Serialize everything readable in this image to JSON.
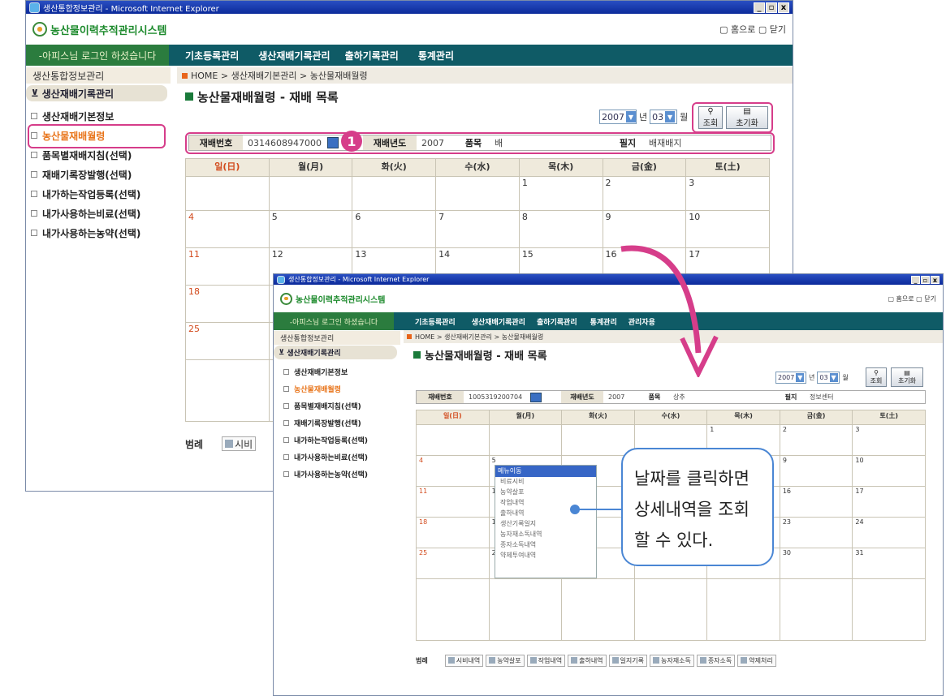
{
  "app_title": "생산통합정보관리 - Microsoft Internet Explorer",
  "win_controls": [
    "_",
    "▫",
    "x"
  ],
  "logo_text": "농산물이력추적관리시스템",
  "top_links": "▢ 홈으로 ▢ 닫기",
  "login_text": "-아피스님 로그인 하셨습니다",
  "menu1": [
    "기초등록관리",
    "생산재배기록관리",
    "출하기록관리",
    "통계관리"
  ],
  "menu2": [
    "기초등록관리",
    "생산재배기록관리",
    "출하기록관리",
    "통계관리",
    "관리자용"
  ],
  "sidebar_title": "생산통합정보관리",
  "sidebar_group": "생산재배기록관리",
  "sidebar_items": [
    "생산재배기본정보",
    "농산물재배월령",
    "품목별재배지침(선택)",
    "재배기록장발행(선택)",
    "내가하는작업등록(선택)",
    "내가사용하는비료(선택)",
    "내가사용하는농약(선택)"
  ],
  "breadcrumb": "HOME > 생산재배기본관리 > 농산물재배월령",
  "page_title": "농산물재배월령 - 재배 목록",
  "year": "2007",
  "year_unit": "년",
  "month": "03",
  "month_unit": "월",
  "btn_search": "조회",
  "btn_reset": "초기화",
  "f1": {
    "lbl_no": "재배번호",
    "no": "0314608947000",
    "lbl_year": "재배년도",
    "year": "2007",
    "lbl_item": "품목",
    "item": "배",
    "lbl_field": "필지",
    "field": "배재배지"
  },
  "f2": {
    "lbl_no": "재배번호",
    "no": "1005319200704",
    "lbl_year": "재배년도",
    "year": "2007",
    "lbl_item": "품목",
    "item": "상추",
    "lbl_field": "필지",
    "field": "정보센터"
  },
  "weekdays": [
    "일(日)",
    "월(月)",
    "화(火)",
    "수(水)",
    "목(木)",
    "금(金)",
    "토(土)"
  ],
  "cal1": [
    [
      "",
      "",
      "",
      "",
      "1",
      "2",
      "3"
    ],
    [
      "4",
      "5",
      "6",
      "7",
      "8",
      "9",
      "10"
    ],
    [
      "11",
      "12",
      "13",
      "14",
      "15",
      "16",
      "17"
    ],
    [
      "18",
      "",
      "",
      "",
      "",
      "",
      ""
    ],
    [
      "25",
      "",
      "",
      "",
      "",
      "",
      ""
    ]
  ],
  "cal2": [
    [
      "",
      "",
      "",
      "",
      "1",
      "2",
      "3"
    ],
    [
      "4",
      "5",
      "",
      "",
      "",
      "9",
      "10"
    ],
    [
      "11",
      "12",
      "",
      "",
      "",
      "16",
      "17"
    ],
    [
      "18",
      "19",
      "",
      "",
      "",
      "23",
      "24"
    ],
    [
      "25",
      "26",
      "",
      "",
      "",
      "30",
      "31"
    ]
  ],
  "legend_label": "범례",
  "legend1_item": "시비",
  "legend2": [
    "시비내역",
    "농약살포",
    "작업내역",
    "출하내역",
    "일지기록",
    "농자재소독",
    "종자소독",
    "약제처리"
  ],
  "badge": "1",
  "popup_title": "메뉴이동",
  "popup_items": [
    "비료시비",
    "농약살포",
    "작업내역",
    "출하내역",
    "생산기록일지",
    "농자재소독내역",
    "종자소독내역",
    "약제투여내역"
  ],
  "callout": [
    "날짜를 클릭하면",
    "상세내역을 조회",
    "할 수 있다."
  ],
  "colors": {
    "accent": "#d63d8a",
    "nav": "#0f5b66",
    "login": "#2b7c3e",
    "sunday": "#d24a1c",
    "callout_border": "#4a86d4"
  }
}
